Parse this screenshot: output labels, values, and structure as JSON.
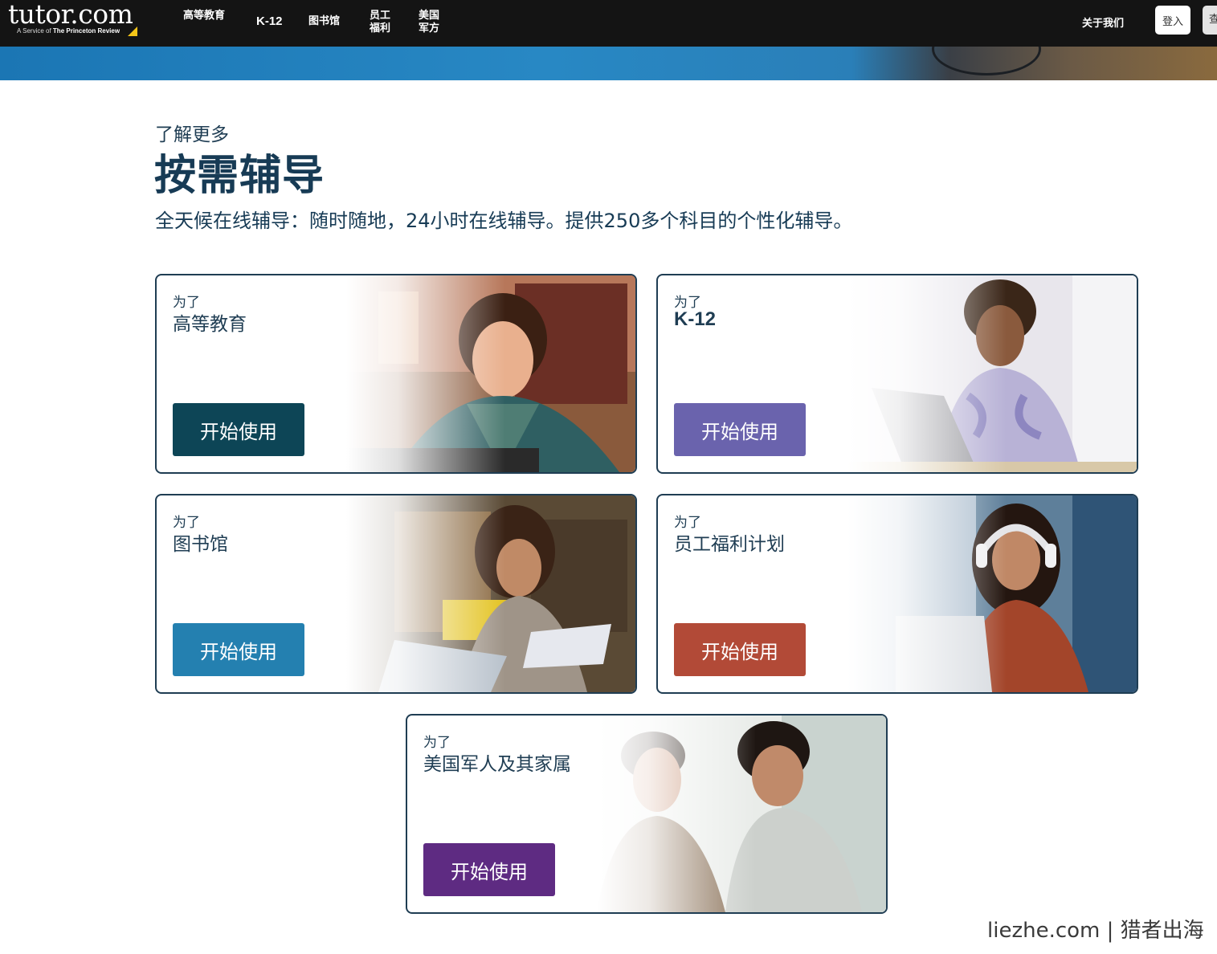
{
  "nav": {
    "logo_text": "tutor.com",
    "logo_tagline_prefix": "A Service of ",
    "logo_tagline_brand": "The Princeton Review",
    "items": [
      {
        "label": "高等教育"
      },
      {
        "label": "K-12"
      },
      {
        "label": "图书馆"
      },
      {
        "label_line1": "员工",
        "label_line2": "福利"
      },
      {
        "label_line1": "美国",
        "label_line2": "军方"
      }
    ],
    "about": "关于我们",
    "login": "登入",
    "edge_button": "查"
  },
  "intro": {
    "eyebrow": "了解更多",
    "headline": "按需辅导",
    "subhead": "全天候在线辅导：随时随地，24小时在线辅导。提供250多个科目的个性化辅导。"
  },
  "cards": [
    {
      "pre": "为了",
      "title": "高等教育",
      "cta": "开始使用",
      "cta_color": "#0d4556"
    },
    {
      "pre": "为了",
      "title": "K-12",
      "cta": "开始使用",
      "cta_color": "#6a63ad"
    },
    {
      "pre": "为了",
      "title": "图书馆",
      "cta": "开始使用",
      "cta_color": "#2480b0"
    },
    {
      "pre": "为了",
      "title": "员工福利计划",
      "cta": "开始使用",
      "cta_color": "#b24a37"
    },
    {
      "pre": "为了",
      "title": "美国军人及其家属",
      "cta": "开始使用",
      "cta_color": "#5e2b82"
    }
  ],
  "watermark": "liezhe.com | 猎者出海",
  "colors": {
    "nav_bg": "#141414",
    "heading": "#173b55",
    "card_border": "#1f3d53",
    "logo_accent": "#f5c518"
  }
}
